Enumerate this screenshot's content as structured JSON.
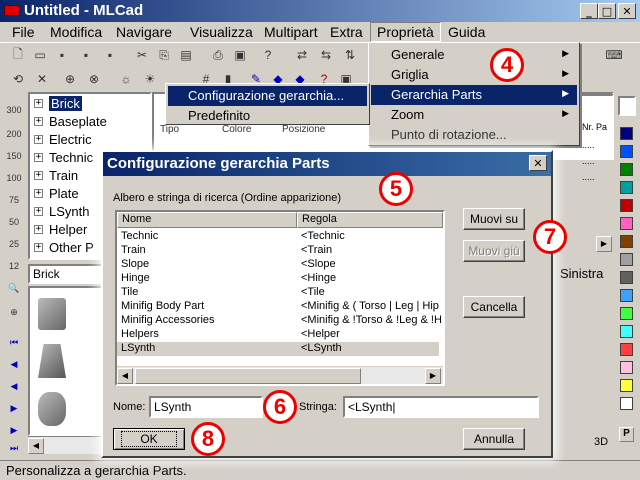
{
  "window": {
    "title": "Untitled - MLCad"
  },
  "menu": [
    "File",
    "Modifica",
    "Navigare",
    "Visualizza",
    "Multipart",
    "Extra",
    "Proprietà",
    "Guida"
  ],
  "proprieta_menu": {
    "items": [
      {
        "label": "Generale",
        "submenu": true
      },
      {
        "label": "Griglia",
        "submenu": true
      },
      {
        "label": "Gerarchia Parts",
        "submenu": true
      },
      {
        "label": "Zoom",
        "submenu": true
      },
      {
        "label": "Punto di rotazione...",
        "submenu": false
      }
    ]
  },
  "gerarchia_submenu": {
    "items": [
      "Configurazione gerarchia...",
      "Predefinito"
    ]
  },
  "tree": {
    "items": [
      "Brick",
      "Baseplate",
      "Electric",
      "Technic",
      "Train",
      "Plate",
      "LSynth",
      "Helper",
      "Other P"
    ],
    "selected": "Brick"
  },
  "parts_combo": {
    "value": "Brick"
  },
  "zoom_labels": [
    "300",
    "200",
    "150",
    "100",
    "75",
    "50",
    "25",
    "12"
  ],
  "list_columns": [
    "Tipo",
    "Colore",
    "Posizione"
  ],
  "right_panel": {
    "col_label": "Nr. Pa",
    "text": "Sinistra",
    "view_label": "3D"
  },
  "palette": {
    "colors": [
      "#000080",
      "#0050ff",
      "#008000",
      "#00a0a0",
      "#c00000",
      "#ff60c0",
      "#804000",
      "#a0a0a0",
      "#606060",
      "#40a0ff",
      "#40ff40",
      "#40ffff",
      "#ff4040",
      "#ffc0e0",
      "#ffff40",
      "#ffffff"
    ],
    "bottom_label": "P"
  },
  "status_bar": {
    "text": "Personalizza a gerarchia Parts."
  },
  "dialog": {
    "title": "Configurazione gerarchia Parts",
    "group_label": "Albero e stringa di ricerca (Ordine apparizione)",
    "columns": [
      "Nome",
      "Regola"
    ],
    "rows": [
      {
        "nome": "Technic",
        "regola": "<Technic"
      },
      {
        "nome": "Train",
        "regola": "<Train"
      },
      {
        "nome": "Slope",
        "regola": "<Slope"
      },
      {
        "nome": "Hinge",
        "regola": "<Hinge"
      },
      {
        "nome": "Tile",
        "regola": "<Tile"
      },
      {
        "nome": "Minifig Body Part",
        "regola": "<Minifig & ( Torso | Leg | Hip"
      },
      {
        "nome": "Minifig Accessories",
        "regola": "<Minifig & !Torso & !Leg & !H"
      },
      {
        "nome": "Helpers",
        "regola": "<Helper"
      },
      {
        "nome": "LSynth",
        "regola": "<LSynth"
      }
    ],
    "selected_row": "LSynth",
    "buttons": {
      "up": "Muovi su",
      "down": "Muovi giù",
      "delete": "Cancella",
      "ok": "OK",
      "cancel": "Annulla"
    },
    "nome_label": "Nome:",
    "nome_value": "LSynth",
    "stringa_label": "Stringa:",
    "stringa_value": "<LSynth|"
  },
  "callouts": [
    "4",
    "5",
    "6",
    "7",
    "8"
  ]
}
